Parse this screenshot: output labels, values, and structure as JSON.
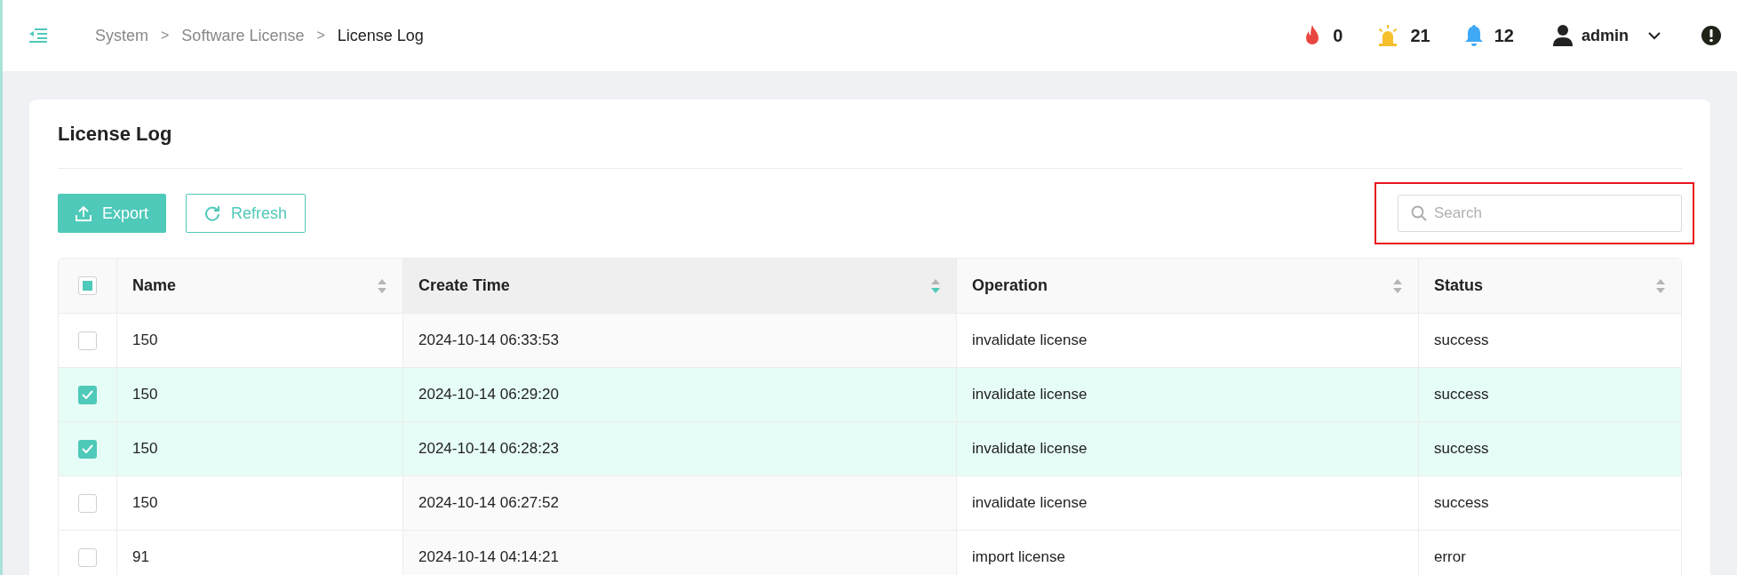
{
  "breadcrumb": [
    {
      "label": "System",
      "current": false
    },
    {
      "label": "Software License",
      "current": false
    },
    {
      "label": "License Log",
      "current": true
    }
  ],
  "breadcrumb_separator": ">",
  "header_counters": [
    {
      "kind": "fire",
      "count": "0"
    },
    {
      "kind": "alarm",
      "count": "21"
    },
    {
      "kind": "bell",
      "count": "12"
    }
  ],
  "user": {
    "name": "admin"
  },
  "page_title": "License Log",
  "toolbar": {
    "buttons": [
      {
        "kind": "primary",
        "label": "Export"
      },
      {
        "kind": "outline",
        "label": "Refresh"
      }
    ],
    "search": {
      "placeholder": "Search",
      "highlighted": true
    }
  },
  "table": {
    "select_all_partial": true,
    "columns": [
      {
        "label": "Name",
        "sorted": false
      },
      {
        "label": "Create Time",
        "sorted": true
      },
      {
        "label": "Operation",
        "sorted": false
      },
      {
        "label": "Status",
        "sorted": false
      }
    ],
    "rows": [
      {
        "selected": false,
        "cells": [
          "150",
          "2024-10-14 06:33:53",
          "invalidate license",
          "success"
        ]
      },
      {
        "selected": true,
        "cells": [
          "150",
          "2024-10-14 06:29:20",
          "invalidate license",
          "success"
        ]
      },
      {
        "selected": true,
        "cells": [
          "150",
          "2024-10-14 06:28:23",
          "invalidate license",
          "success"
        ]
      },
      {
        "selected": false,
        "cells": [
          "150",
          "2024-10-14 06:27:52",
          "invalidate license",
          "success"
        ]
      },
      {
        "selected": false,
        "cells": [
          "91",
          "2024-10-14 04:14:21",
          "import license",
          "error"
        ]
      }
    ]
  }
}
